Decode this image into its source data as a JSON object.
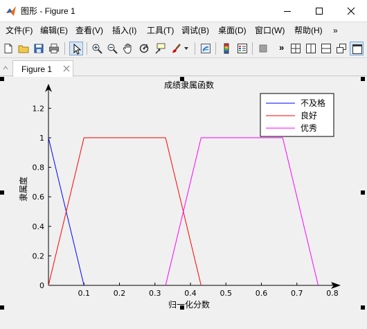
{
  "window": {
    "title": "图形 - Figure 1",
    "minimize_label": "minimize",
    "maximize_label": "maximize",
    "close_label": "close"
  },
  "menu": [
    "文件(F)",
    "编辑(E)",
    "查看(V)",
    "插入(I)",
    "工具(T)",
    "调试(B)",
    "桌面(D)",
    "窗口(W)",
    "帮助(H)"
  ],
  "menu_overflow": "»",
  "toolbar_overflow": "»",
  "tab": {
    "label": "Figure 1"
  },
  "chart_data": {
    "type": "line",
    "title": "成绩隶属函数",
    "xlabel": "归一化分数",
    "ylabel": "隶属度",
    "xlim": [
      0,
      0.8
    ],
    "ylim": [
      0,
      1.3
    ],
    "xticks": [
      0.1,
      0.2,
      0.3,
      0.4,
      0.5,
      0.6,
      0.7,
      0.8
    ],
    "xtick_labels": [
      "0.1",
      "0.2",
      "0.3",
      "0.4",
      "0.5",
      "0.6",
      "0.7",
      "0.8"
    ],
    "yticks": [
      0,
      0.2,
      0.4,
      0.6,
      0.8,
      1,
      1.2
    ],
    "ytick_labels": [
      "0",
      "0.2",
      "0.4",
      "0.6",
      "0.8",
      "1",
      "1.2"
    ],
    "grid": false,
    "legend_position": "top-right",
    "series": [
      {
        "name": "不及格",
        "color": "#0000ff",
        "x": [
          0,
          0.1
        ],
        "y": [
          1,
          0
        ]
      },
      {
        "name": "良好",
        "color": "#ff0000",
        "x": [
          0,
          0.1,
          0.33,
          0.43
        ],
        "y": [
          0,
          1,
          1,
          0
        ]
      },
      {
        "name": "优秀",
        "color": "#ff00ff",
        "x": [
          0.33,
          0.43,
          0.66,
          0.76
        ],
        "y": [
          0,
          1,
          1,
          0
        ]
      }
    ]
  }
}
